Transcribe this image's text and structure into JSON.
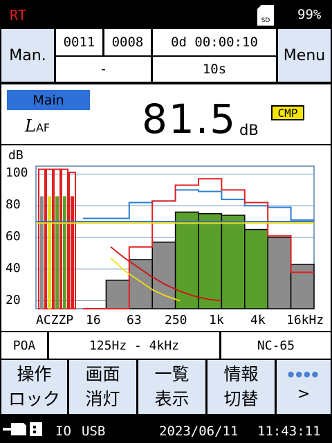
{
  "status_bar": {
    "mode": "RT",
    "battery": "99%"
  },
  "header": {
    "mode_button": "Man.",
    "counter_a": "0011",
    "counter_b": "0008",
    "elapsed": "0d 00:00:10",
    "sub_left": "-",
    "sub_right": "10s",
    "menu_button": "Menu"
  },
  "main": {
    "label": "Main",
    "param": "L",
    "param_sub": "AF",
    "value": "81.5",
    "unit": "dB",
    "badge": "CMP"
  },
  "chart_data": {
    "type": "bar",
    "ylabel": "dB",
    "ylim": [
      15,
      105
    ],
    "y_ticks": [
      100,
      80,
      60,
      40,
      20
    ],
    "x_tick_labels": [
      "ACZZP",
      "16",
      "63",
      "250",
      "1k",
      "4k",
      "16kHz"
    ],
    "overall_labels": [
      "A",
      "C",
      "Z",
      "Z",
      "P"
    ],
    "overall_values": [
      86,
      86,
      86,
      86,
      86
    ],
    "overall_max": [
      103,
      103,
      103,
      103,
      101
    ],
    "band_values": [
      15,
      33,
      46,
      57,
      76,
      75,
      74,
      65,
      60,
      43
    ],
    "band_max_red": [
      15,
      15,
      54,
      83,
      93,
      97,
      90,
      82,
      61,
      38
    ],
    "band_max_blue": [
      72,
      72,
      82,
      83,
      90,
      89,
      84,
      80,
      79,
      71
    ],
    "ref_lines": [
      70,
      69
    ],
    "nc_curve": [
      [
        1.2,
        54
      ],
      [
        1.8,
        47
      ],
      [
        2.4,
        41
      ],
      [
        3.0,
        35
      ],
      [
        3.6,
        30
      ],
      [
        4.2,
        26
      ],
      [
        4.8,
        23
      ],
      [
        5.4,
        21
      ],
      [
        6.0,
        20
      ]
    ],
    "nc_curve_2": [
      [
        1.2,
        47
      ],
      [
        1.8,
        39
      ],
      [
        2.4,
        33
      ],
      [
        3.0,
        27
      ],
      [
        3.6,
        23
      ],
      [
        4.2,
        20
      ]
    ]
  },
  "footer_info": {
    "source": "POA",
    "range": "125Hz - 4kHz",
    "nc": "NC-65"
  },
  "buttons": [
    {
      "line1": "操作",
      "line2": "ロック"
    },
    {
      "line1": "画面",
      "line2": "消灯"
    },
    {
      "line1": "一覧",
      "line2": "表示"
    },
    {
      "line1": "情報",
      "line2": "切替"
    },
    {
      "line1": "●●●●",
      "line2": ">"
    }
  ],
  "bottom_bar": {
    "io": "IO",
    "usb": "USB",
    "date": "2023/06/11",
    "time": "11:43:11"
  },
  "colors": {
    "band_fill": "#5a9f2c",
    "band_gray": "#8c8c8c",
    "red": "#e02020",
    "blue": "#2a7fd0",
    "yellow": "#f0e010",
    "button_bg": "#dce6f4",
    "main_label_bg": "#2e6fd8"
  }
}
